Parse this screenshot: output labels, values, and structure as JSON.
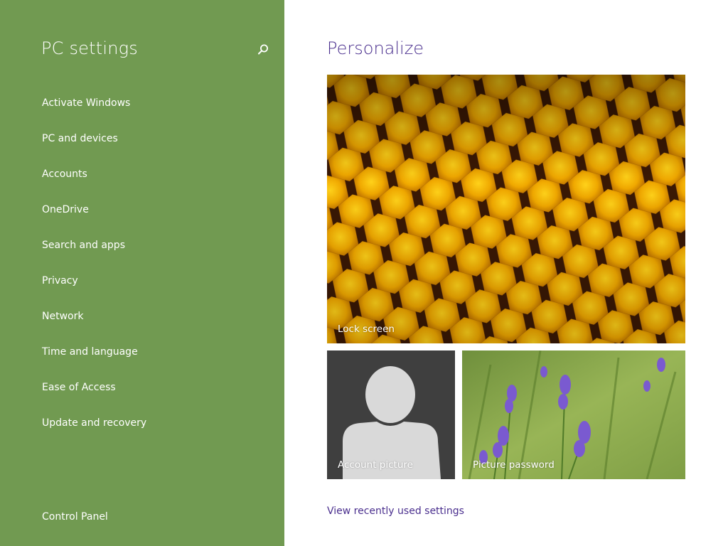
{
  "sidebar": {
    "title": "PC settings",
    "search_icon": "search-icon",
    "items": [
      {
        "label": "Activate Windows"
      },
      {
        "label": "PC and devices"
      },
      {
        "label": "Accounts"
      },
      {
        "label": "OneDrive"
      },
      {
        "label": "Search and apps"
      },
      {
        "label": "Privacy"
      },
      {
        "label": "Network"
      },
      {
        "label": "Time and language"
      },
      {
        "label": "Ease of Access"
      },
      {
        "label": "Update and recovery"
      }
    ],
    "footer_link": "Control Panel"
  },
  "main": {
    "title": "Personalize",
    "tiles": {
      "lock_screen": "Lock screen",
      "account_picture": "Account picture",
      "picture_password": "Picture password"
    },
    "recent_link": "View recently used settings"
  },
  "colors": {
    "sidebar_bg": "#719a51",
    "accent": "#4a2f8e",
    "account_tile_bg": "#3f3f3f"
  }
}
